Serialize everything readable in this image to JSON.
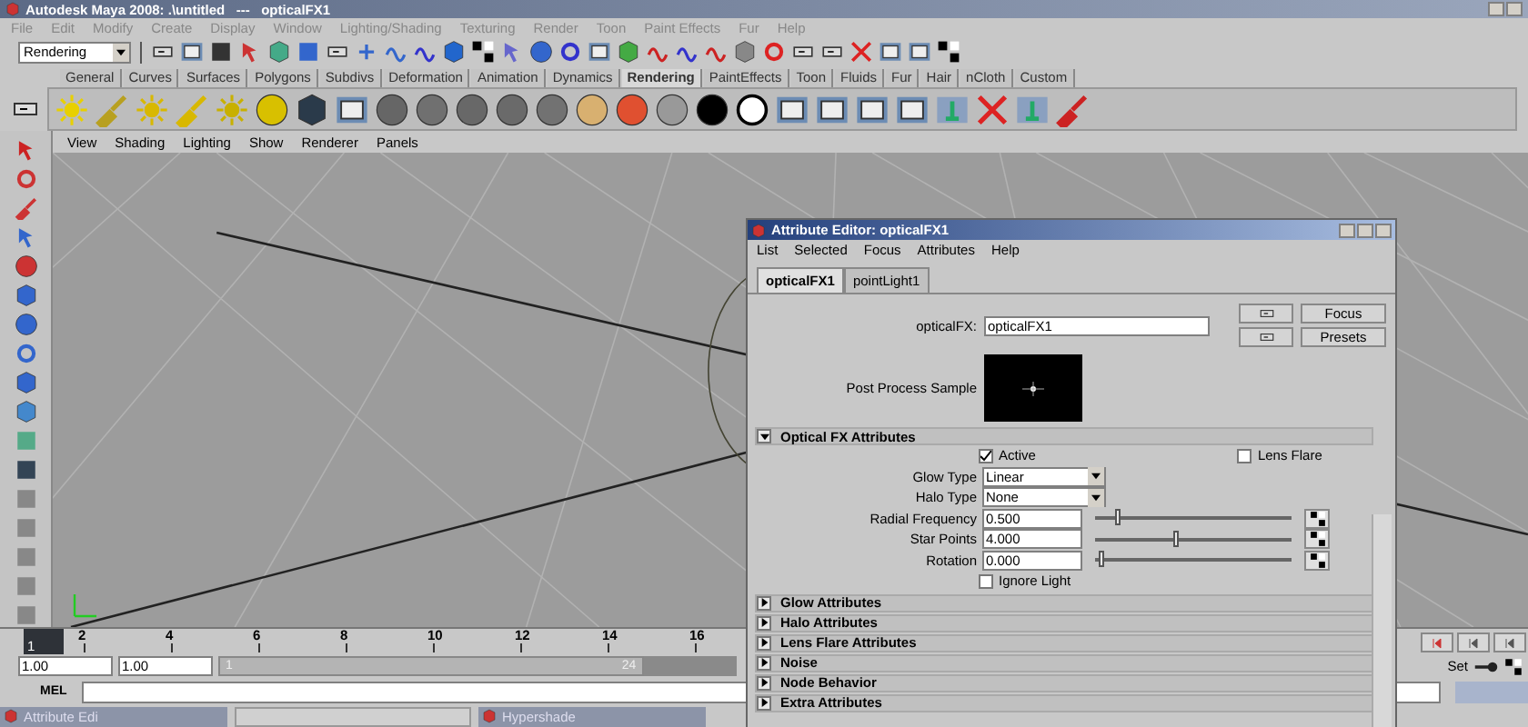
{
  "window": {
    "title": "Autodesk Maya 2008: .\\untitled   ---   opticalFX1"
  },
  "menu": [
    "File",
    "Edit",
    "Modify",
    "Create",
    "Display",
    "Window",
    "Lighting/Shading",
    "Texturing",
    "Render",
    "Toon",
    "Paint Effects",
    "Fur",
    "Help"
  ],
  "status_line": {
    "menu_set": "Rendering"
  },
  "shelf_tabs": [
    {
      "label": "General",
      "selected": false
    },
    {
      "label": "Curves",
      "selected": false
    },
    {
      "label": "Surfaces",
      "selected": false
    },
    {
      "label": "Polygons",
      "selected": false
    },
    {
      "label": "Subdivs",
      "selected": false
    },
    {
      "label": "Deformation",
      "selected": false
    },
    {
      "label": "Animation",
      "selected": false
    },
    {
      "label": "Dynamics",
      "selected": false
    },
    {
      "label": "Rendering",
      "selected": true
    },
    {
      "label": "PaintEffects",
      "selected": false
    },
    {
      "label": "Toon",
      "selected": false
    },
    {
      "label": "Fluids",
      "selected": false
    },
    {
      "label": "Fur",
      "selected": false
    },
    {
      "label": "Hair",
      "selected": false
    },
    {
      "label": "nCloth",
      "selected": false
    },
    {
      "label": "Custom",
      "selected": false
    }
  ],
  "viewport": {
    "menu": [
      "View",
      "Shading",
      "Lighting",
      "Show",
      "Renderer",
      "Panels"
    ]
  },
  "attribute_editor": {
    "title": "Attribute Editor: opticalFX1",
    "menu": [
      "List",
      "Selected",
      "Focus",
      "Attributes",
      "Help"
    ],
    "tabs": [
      {
        "label": "opticalFX1",
        "selected": true
      },
      {
        "label": "pointLight1",
        "selected": false
      }
    ],
    "node_label": "opticalFX:",
    "node_value": "opticalFX1",
    "buttons": [
      "Focus",
      "Presets"
    ],
    "sample_label": "Post Process Sample",
    "sections": [
      {
        "title": "Optical FX Attributes",
        "expanded": true,
        "rows": [
          {
            "kind": "checks",
            "items": [
              {
                "label": "Active",
                "checked": true
              },
              {
                "label": "Lens Flare",
                "checked": false
              }
            ]
          },
          {
            "kind": "dropdown",
            "label": "Glow Type",
            "value": "Linear"
          },
          {
            "kind": "dropdown",
            "label": "Halo Type",
            "value": "None"
          },
          {
            "kind": "slider",
            "label": "Radial Frequency",
            "value": "0.500",
            "level": 0.1
          },
          {
            "kind": "slider",
            "label": "Star Points",
            "value": "4.000",
            "level": 0.4
          },
          {
            "kind": "slider",
            "label": "Rotation",
            "value": "0.000",
            "level": 0.02
          },
          {
            "kind": "checks",
            "items": [
              {
                "label": "Ignore Light",
                "checked": false
              }
            ]
          }
        ]
      },
      {
        "title": "Glow Attributes",
        "expanded": false
      },
      {
        "title": "Halo Attributes",
        "expanded": false
      },
      {
        "title": "Lens Flare Attributes",
        "expanded": false
      },
      {
        "title": "Noise",
        "expanded": false
      },
      {
        "title": "Node Behavior",
        "expanded": false
      },
      {
        "title": "Extra Attributes",
        "expanded": false
      }
    ]
  },
  "timeline": {
    "level": 0,
    "current_frame": "1",
    "ticks": [
      "2",
      "4",
      "6",
      "8",
      "10",
      "12",
      "14",
      "16"
    ]
  },
  "range_slider": {
    "level": 0.82,
    "start": "1.00",
    "playback_start": "1.00",
    "range_start": "1",
    "range_end": "24"
  },
  "key_controls": {
    "set_label": "Set"
  },
  "command_line": {
    "label": "MEL"
  },
  "taskbar": [
    {
      "title": "Attribute Edi"
    },
    {
      "title": "Hypershade"
    }
  ]
}
